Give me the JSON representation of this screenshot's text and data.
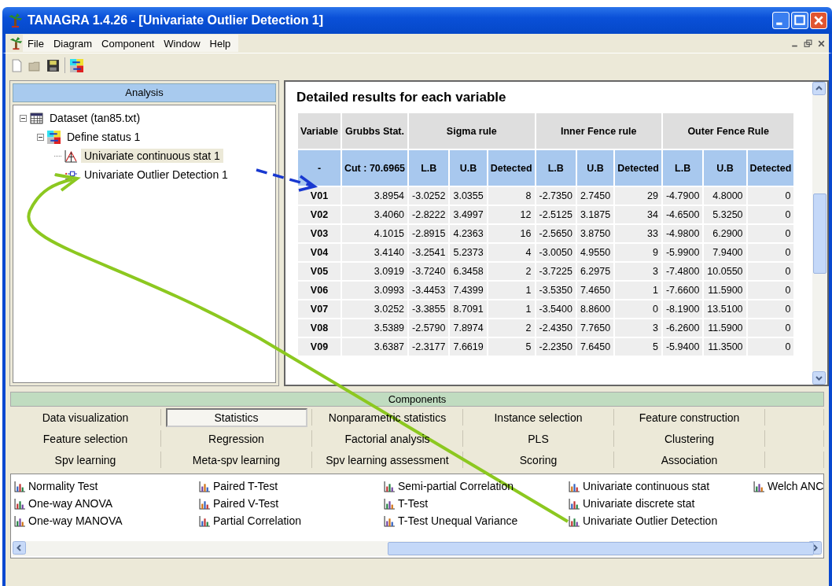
{
  "window": {
    "title": "TANAGRA 1.4.26 - [Univariate Outlier Detection 1]"
  },
  "menu": [
    "File",
    "Diagram",
    "Component",
    "Window",
    "Help"
  ],
  "analysis": {
    "title": "Analysis",
    "tree": [
      {
        "label": "Dataset (tan85.txt)",
        "kind": "dataset",
        "selected": false,
        "expanded": true,
        "children": [
          {
            "label": "Define status 1",
            "kind": "status",
            "selected": false,
            "expanded": true,
            "children": [
              {
                "label": "Univariate continuous stat 1",
                "kind": "stat",
                "selected": true
              },
              {
                "label": "Univariate Outlier Detection 1",
                "kind": "outlier",
                "selected": false
              }
            ]
          }
        ]
      }
    ]
  },
  "results": {
    "title": "Detailed results for each variable",
    "table": {
      "variable_header": "Variable",
      "grubbs_header": "Grubbs Stat.",
      "sub_variable": "-",
      "sub_grubbs": "Cut : 70.6965",
      "groups": [
        {
          "label": "Sigma rule",
          "columns": [
            "L.B",
            "U.B",
            "Detected"
          ]
        },
        {
          "label": "Inner Fence rule",
          "columns": [
            "L.B",
            "U.B",
            "Detected"
          ]
        },
        {
          "label": "Outer Fence Rule",
          "columns": [
            "L.B",
            "U.B",
            "Detected"
          ]
        }
      ],
      "rows": [
        {
          "variable": "V01",
          "values": [
            "3.8954",
            "-3.0252",
            "3.0355",
            "8",
            "-2.7350",
            "2.7450",
            "29",
            "-4.7900",
            "4.8000",
            "0"
          ]
        },
        {
          "variable": "V02",
          "values": [
            "3.4060",
            "-2.8222",
            "3.4997",
            "12",
            "-2.5125",
            "3.1875",
            "34",
            "-4.6500",
            "5.3250",
            "0"
          ]
        },
        {
          "variable": "V03",
          "values": [
            "4.1015",
            "-2.8915",
            "4.2363",
            "16",
            "-2.5650",
            "3.8750",
            "33",
            "-4.9800",
            "6.2900",
            "0"
          ]
        },
        {
          "variable": "V04",
          "values": [
            "3.4140",
            "-3.2541",
            "5.2373",
            "4",
            "-3.0050",
            "4.9550",
            "9",
            "-5.9900",
            "7.9400",
            "0"
          ]
        },
        {
          "variable": "V05",
          "values": [
            "3.0919",
            "-3.7240",
            "6.3458",
            "2",
            "-3.7225",
            "6.2975",
            "3",
            "-7.4800",
            "10.0550",
            "0"
          ]
        },
        {
          "variable": "V06",
          "values": [
            "3.0993",
            "-3.4453",
            "7.4399",
            "1",
            "-3.5350",
            "7.4650",
            "1",
            "-7.6600",
            "11.5900",
            "0"
          ]
        },
        {
          "variable": "V07",
          "values": [
            "3.0252",
            "-3.3855",
            "8.7091",
            "1",
            "-3.5400",
            "8.8600",
            "0",
            "-8.1900",
            "13.5100",
            "0"
          ]
        },
        {
          "variable": "V08",
          "values": [
            "3.5389",
            "-2.5790",
            "7.8974",
            "2",
            "-2.4350",
            "7.7650",
            "3",
            "-6.2600",
            "11.5900",
            "0"
          ]
        },
        {
          "variable": "V09",
          "values": [
            "3.6387",
            "-2.3177",
            "7.6619",
            "5",
            "-2.2350",
            "7.6450",
            "5",
            "-5.9400",
            "11.3500",
            "0"
          ]
        }
      ]
    }
  },
  "components": {
    "title": "Components",
    "tabs": [
      {
        "label": "Data visualization",
        "selected": false
      },
      {
        "label": "Statistics",
        "selected": true
      },
      {
        "label": "Nonparametric statistics",
        "selected": false
      },
      {
        "label": "Instance selection",
        "selected": false
      },
      {
        "label": "Feature construction",
        "selected": false
      },
      {
        "label": "Feature selection",
        "selected": false
      },
      {
        "label": "Regression",
        "selected": false
      },
      {
        "label": "Factorial analysis",
        "selected": false
      },
      {
        "label": "PLS",
        "selected": false
      },
      {
        "label": "Clustering",
        "selected": false
      },
      {
        "label": "Spv learning",
        "selected": false
      },
      {
        "label": "Meta-spv learning",
        "selected": false
      },
      {
        "label": "Spv learning assessment",
        "selected": false
      },
      {
        "label": "Scoring",
        "selected": false
      },
      {
        "label": "Association",
        "selected": false
      }
    ],
    "items": [
      "Normality Test",
      "One-way ANOVA",
      "One-way MANOVA",
      "Paired T-Test",
      "Paired V-Test",
      "Partial Correlation",
      "Semi-partial Correlation",
      "T-Test",
      "T-Test Unequal Variance",
      "Univariate continuous stat",
      "Univariate discrete stat",
      "Univariate Outlier Detection",
      "Welch ANC"
    ]
  }
}
